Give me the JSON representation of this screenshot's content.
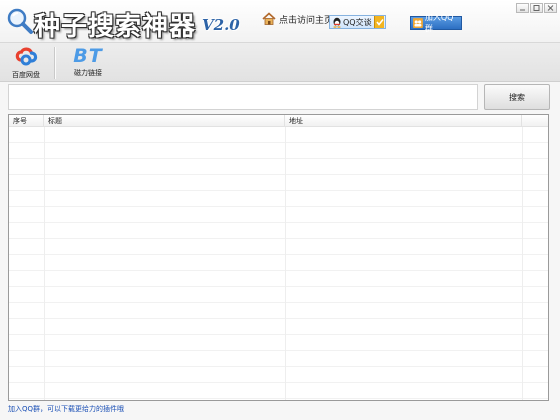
{
  "app": {
    "title": "种子搜索神器",
    "version": "V2.0"
  },
  "header": {
    "home_link": "点击访问主页",
    "qq_chat": "QQ交谈",
    "join_qq_group": "加入QQ群"
  },
  "toolbar": {
    "items": [
      {
        "label": "百度网盘",
        "icon": "baidu-cloud-icon"
      },
      {
        "label": "磁力链接",
        "icon": "bt-icon",
        "glyph": "BT"
      }
    ]
  },
  "search": {
    "value": "",
    "placeholder": "",
    "button_label": "搜索"
  },
  "results": {
    "columns": [
      "序号",
      "标题",
      "地址",
      ""
    ],
    "rows": []
  },
  "status_bar": {
    "text": "加入QQ群，可以下载更给力的插件哦"
  },
  "colors": {
    "accent": "#2d63a7",
    "bt_icon": "#4d9be6",
    "status_link": "#1a4fb5",
    "join_button": "#2c6fc2",
    "qq_dropdown": "#f2b521"
  }
}
